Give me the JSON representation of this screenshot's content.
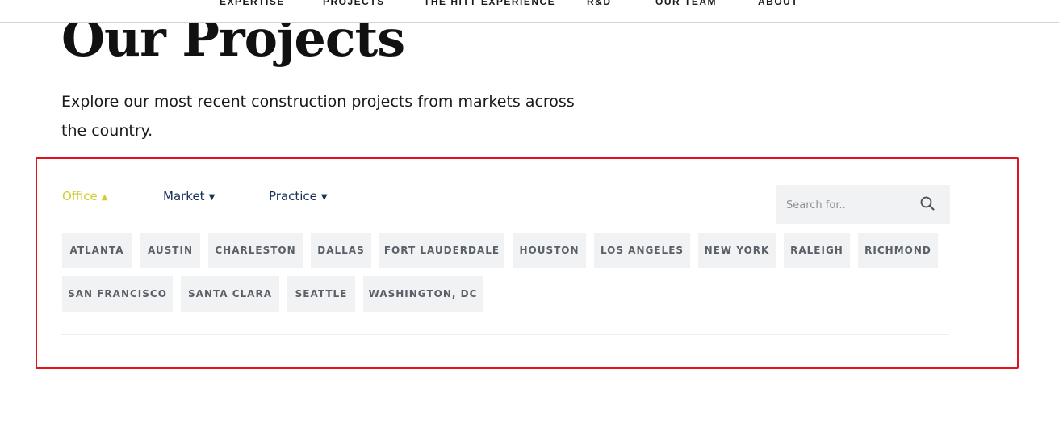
{
  "nav": {
    "items": [
      "EXPERTISE",
      "PROJECTS",
      "THE HITT EXPERIENCE",
      "R&D",
      "OUR TEAM",
      "ABOUT"
    ]
  },
  "page": {
    "title": "Our Projects",
    "intro": "Explore our most recent construction projects from markets across the country."
  },
  "filters": {
    "tabs": [
      {
        "label": "Office",
        "caret": "▲"
      },
      {
        "label": "Market",
        "caret": "▼"
      },
      {
        "label": "Practice",
        "caret": "▼"
      }
    ],
    "search_placeholder": "Search for..",
    "offices": [
      "ATLANTA",
      "AUSTIN",
      "CHARLESTON",
      "DALLAS",
      "FORT LAUDERDALE",
      "HOUSTON",
      "LOS ANGELES",
      "NEW YORK",
      "RALEIGH",
      "RICHMOND",
      "SAN FRANCISCO",
      "SANTA CLARA",
      "SEATTLE",
      "WASHINGTON, DC"
    ]
  },
  "colors": {
    "accent_active": "#d3cc2f",
    "tab_text": "#17305a",
    "highlight_border": "#e0121b",
    "tag_bg": "#f1f2f4"
  }
}
